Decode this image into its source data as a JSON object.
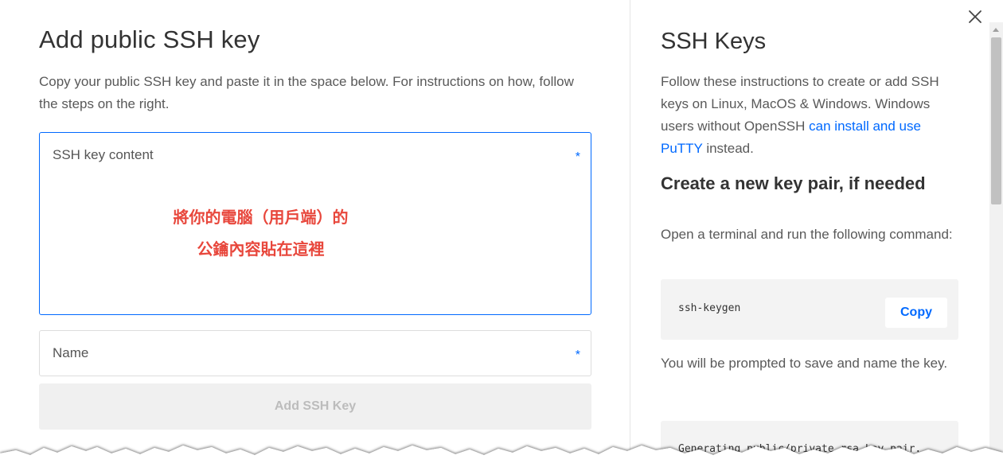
{
  "form": {
    "title": "Add public SSH key",
    "description": "Copy your public SSH key and paste it in the space below. For instructions on how, follow the steps on the right.",
    "key_content_label": "SSH key content",
    "key_content_required": "*",
    "annotation_line1": "將你的電腦（用戶端）的",
    "annotation_line2": "公鑰內容貼在這裡",
    "name_label": "Name",
    "name_required": "*",
    "submit_label": "Add SSH Key"
  },
  "help": {
    "title": "SSH Keys",
    "intro": "Follow these instructions to create or add SSH keys on Linux, MacOS & Windows. Windows users without OpenSSH ",
    "intro_link": "can install and use PuTTY",
    "intro_after": " instead.",
    "heading": "Create a new key pair, if needed",
    "step1": "Open a terminal and run the following command:",
    "command": "ssh-keygen",
    "copy_label": "Copy",
    "step2": "You will be prompted to save and name the key.",
    "output_partial": "Generating public/private rsa key pair."
  },
  "colors": {
    "accent": "#0069ff",
    "annotation": "#e8473c",
    "disabled_bg": "#f0f0f0",
    "disabled_text": "#bcbcbc"
  },
  "icons": {
    "close": "close-icon"
  }
}
